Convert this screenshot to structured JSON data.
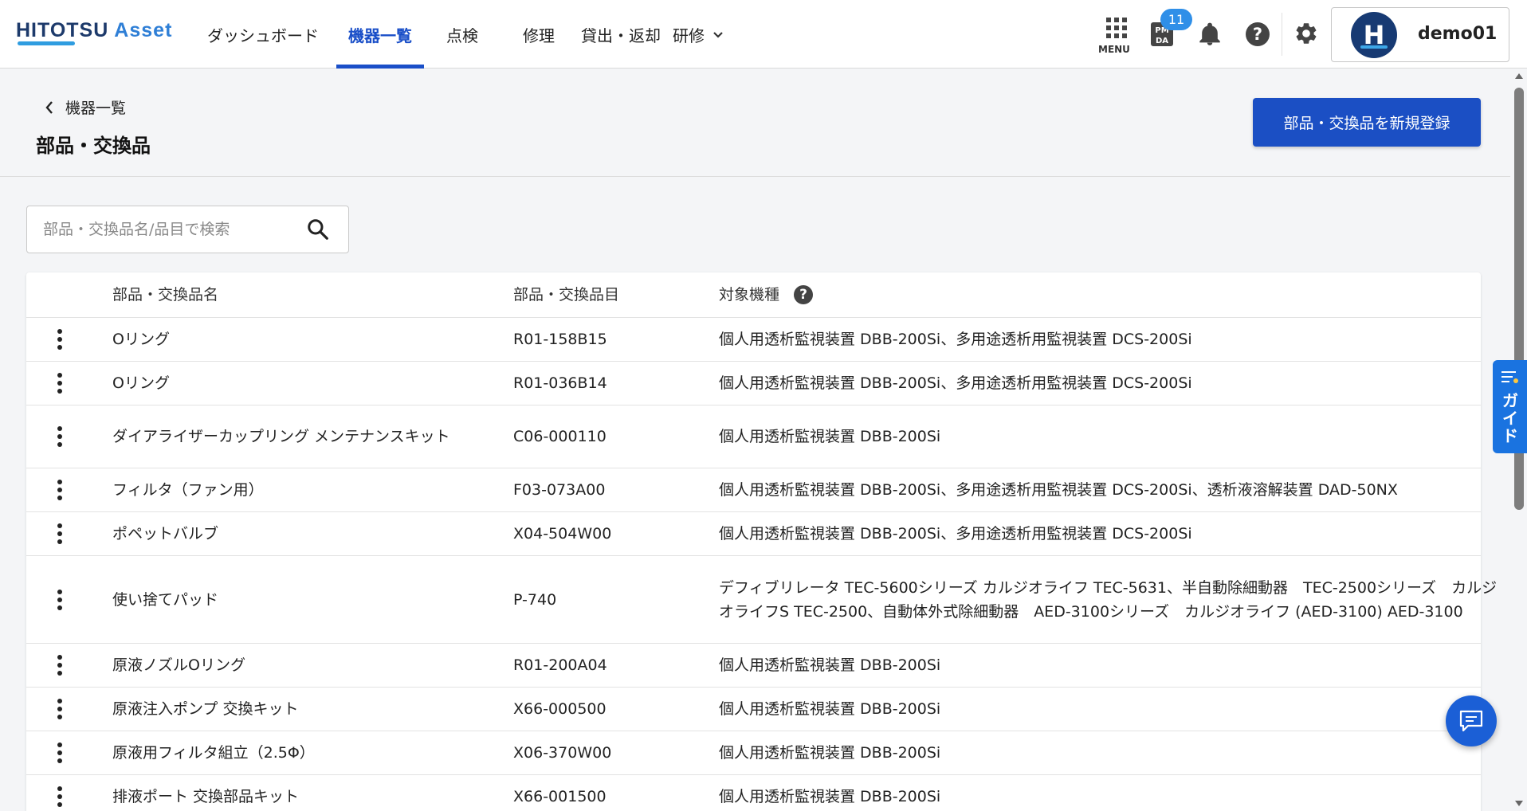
{
  "brand": {
    "part1": "HITOTSU",
    "part2": "Asset"
  },
  "nav": [
    {
      "label": "ダッシュボード"
    },
    {
      "label": "機器一覧",
      "active": true
    },
    {
      "label": "点検"
    },
    {
      "label": "修理"
    },
    {
      "label": "貸出・返却"
    },
    {
      "label": "研修"
    }
  ],
  "header": {
    "menu_label": "MENU",
    "pmda_label_top": "PM",
    "pmda_label_bottom": "DA",
    "pmda_badge": "11",
    "avatar_initial": "H",
    "username": "demo01"
  },
  "page": {
    "back_label": "機器一覧",
    "title": "部品・交換品",
    "new_button": "部品・交換品を新規登録"
  },
  "search": {
    "placeholder": "部品・交換品名/品目で検索",
    "value": ""
  },
  "table": {
    "headers": {
      "name": "部品・交換品名",
      "code": "部品・交換品目",
      "target": "対象機種",
      "help": "?"
    },
    "rows": [
      {
        "name": "Oリング",
        "code": "R01-158B15",
        "target": "個人用透析監視装置 DBB-200Si、多用途透析用監視装置 DCS-200Si"
      },
      {
        "name": "Oリング",
        "code": "R01-036B14",
        "target": "個人用透析監視装置 DBB-200Si、多用途透析用監視装置 DCS-200Si"
      },
      {
        "name": "ダイアライザーカップリング メンテナンスキット",
        "code": "C06-000110",
        "target": "個人用透析監視装置 DBB-200Si"
      },
      {
        "name": "フィルタ（ファン用）",
        "code": "F03-073A00",
        "target": "個人用透析監視装置 DBB-200Si、多用途透析用監視装置 DCS-200Si、透析液溶解装置 DAD-50NX"
      },
      {
        "name": "ポペットバルブ",
        "code": "X04-504W00",
        "target": "個人用透析監視装置 DBB-200Si、多用途透析用監視装置 DCS-200Si"
      },
      {
        "name": "使い捨てパッド",
        "code": "P-740",
        "target": "デフィブリレータ TEC-5600シリーズ カルジオライフ TEC-5631、半自動除細動器　TEC-2500シリーズ　カルジオライフS TEC-2500、自動体外式除細動器　AED-3100シリーズ　カルジオライフ (AED-3100) AED-3100"
      },
      {
        "name": "原液ノズルOリング",
        "code": "R01-200A04",
        "target": "個人用透析監視装置 DBB-200Si"
      },
      {
        "name": "原液注入ポンプ 交換キット",
        "code": "X66-000500",
        "target": "個人用透析監視装置 DBB-200Si"
      },
      {
        "name": "原液用フィルタ組立（2.5Φ）",
        "code": "X06-370W00",
        "target": "個人用透析監視装置 DBB-200Si"
      },
      {
        "name": "排液ポート 交換部品キット",
        "code": "X66-001500",
        "target": "個人用透析監視装置 DBB-200Si"
      }
    ]
  },
  "guide": {
    "label": "ガイド"
  },
  "colors": {
    "primary": "#1b4fc4",
    "brand_dark": "#1d3a6b",
    "brand_light": "#2f7fd6",
    "guide": "#1a73e0"
  }
}
